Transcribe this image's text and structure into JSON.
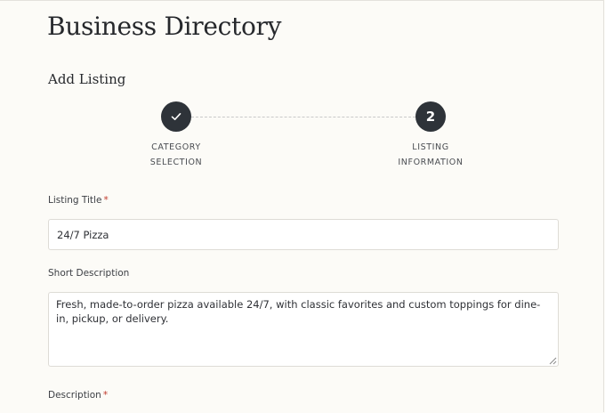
{
  "page": {
    "title": "Business Directory",
    "section_title": "Add Listing"
  },
  "stepper": {
    "steps": [
      {
        "label_line1": "CATEGORY",
        "label_line2": "SELECTION",
        "state": "completed",
        "icon": "checkmark-icon"
      },
      {
        "label_line1": "LISTING",
        "label_line2": "INFORMATION",
        "state": "current",
        "number": "2"
      }
    ]
  },
  "form": {
    "listing_title": {
      "label": "Listing Title",
      "required_mark": "*",
      "value": "24/7 Pizza"
    },
    "short_description": {
      "label": "Short Description",
      "value": "Fresh, made-to-order pizza available 24/7, with classic favorites and custom toppings for dine-in, pickup, or delivery."
    },
    "description": {
      "label": "Description",
      "required_mark": "*"
    }
  },
  "colors": {
    "background": "#fcfbf7",
    "step_circle": "#2e3339",
    "required": "#c0392b"
  }
}
